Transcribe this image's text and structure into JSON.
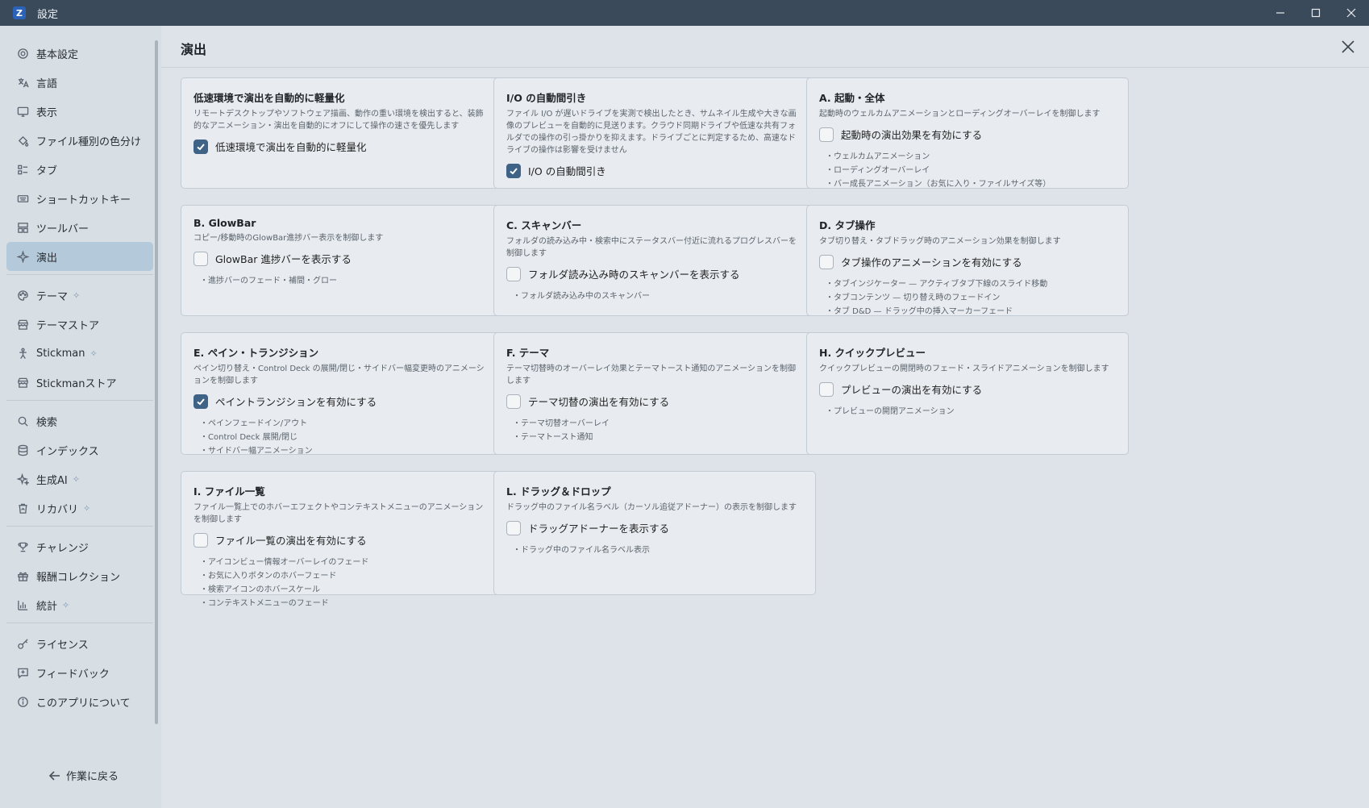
{
  "window": {
    "title": "設定",
    "app_icon_letter": "Z"
  },
  "sidebar": {
    "items": [
      {
        "label": "基本設定",
        "icon": "gear-icon"
      },
      {
        "label": "言語",
        "icon": "translate-icon"
      },
      {
        "label": "表示",
        "icon": "monitor-icon"
      },
      {
        "label": "ファイル種別の色分け",
        "icon": "paint-bucket-icon"
      },
      {
        "label": "タブ",
        "icon": "tabs-list-icon"
      },
      {
        "label": "ショートカットキー",
        "icon": "keyboard-icon"
      },
      {
        "label": "ツールバー",
        "icon": "toolbar-grid-icon"
      },
      {
        "label": "演出",
        "icon": "sparkle-icon",
        "active": true
      },
      {
        "label": "テーマ",
        "icon": "palette-icon",
        "sparkle": true
      },
      {
        "label": "テーマストア",
        "icon": "store-icon"
      },
      {
        "label": "Stickman",
        "icon": "stickman-icon",
        "sparkle": true
      },
      {
        "label": "Stickmanストア",
        "icon": "store-icon"
      },
      {
        "label": "検索",
        "icon": "search-icon"
      },
      {
        "label": "インデックス",
        "icon": "database-icon"
      },
      {
        "label": "生成AI",
        "icon": "ai-sparkle-icon",
        "sparkle": true
      },
      {
        "label": "リカバリ",
        "icon": "trash-restore-icon",
        "sparkle": true
      },
      {
        "label": "チャレンジ",
        "icon": "trophy-icon"
      },
      {
        "label": "報酬コレクション",
        "icon": "gift-icon"
      },
      {
        "label": "統計",
        "icon": "bar-chart-icon",
        "sparkle": true
      },
      {
        "label": "ライセンス",
        "icon": "key-icon"
      },
      {
        "label": "フィードバック",
        "icon": "feedback-icon"
      },
      {
        "label": "このアプリについて",
        "icon": "info-icon"
      }
    ],
    "back_label": "作業に戻る"
  },
  "main": {
    "title": "演出",
    "cards": [
      {
        "title": "低速環境で演出を自動的に軽量化",
        "desc": "リモートデスクトップやソフトウェア描画、動作の重い環境を検出すると、装飾的なアニメーション・演出を自動的にオフにして操作の速さを優先します",
        "checkbox_label": "低速環境で演出を自動的に軽量化",
        "checked": true,
        "bullets": []
      },
      {
        "title": "I/O の自動間引き",
        "desc": "ファイル I/O が遅いドライブを実測で検出したとき、サムネイル生成や大きな画像のプレビューを自動的に見送ります。クラウド同期ドライブや低速な共有フォルダでの操作の引っ掛かりを抑えます。ドライブごとに判定するため、高速なドライブの操作は影響を受けません",
        "checkbox_label": "I/O の自動間引き",
        "checked": true,
        "bullets": []
      },
      {
        "title": "A. 起動・全体",
        "desc": "起動時のウェルカムアニメーションとローディングオーバーレイを制御します",
        "checkbox_label": "起動時の演出効果を有効にする",
        "checked": false,
        "bullets": [
          "ウェルカムアニメーション",
          "ローディングオーバーレイ",
          "バー成長アニメーション（お気に入り・ファイルサイズ等）"
        ]
      },
      {
        "title": "B. GlowBar",
        "desc": "コピー/移動時のGlowBar進捗バー表示を制御します",
        "checkbox_label": "GlowBar 進捗バーを表示する",
        "checked": false,
        "bullets": [
          "進捗バーのフェード・補間・グロー"
        ]
      },
      {
        "title": "C. スキャンバー",
        "desc": "フォルダの読み込み中・検索中にステータスバー付近に流れるプログレスバーを制御します",
        "checkbox_label": "フォルダ読み込み時のスキャンバーを表示する",
        "checked": false,
        "bullets": [
          "フォルダ読み込み中のスキャンバー"
        ]
      },
      {
        "title": "D. タブ操作",
        "desc": "タブ切り替え・タブドラッグ時のアニメーション効果を制御します",
        "checkbox_label": "タブ操作のアニメーションを有効にする",
        "checked": false,
        "bullets": [
          "タブインジケーター — アクティブタブ下線のスライド移動",
          "タブコンテンツ — 切り替え時のフェードイン",
          "タブ D&D — ドラッグ中の挿入マーカーフェード"
        ]
      },
      {
        "title": "E. ペイン・トランジション",
        "desc": "ペイン切り替え・Control Deck の展開/閉じ・サイドバー幅変更時のアニメーションを制御します",
        "checkbox_label": "ペイントランジションを有効にする",
        "checked": true,
        "bullets": [
          "ペインフェードイン/アウト",
          "Control Deck 展開/閉じ",
          "サイドバー幅アニメーション"
        ]
      },
      {
        "title": "F. テーマ",
        "desc": "テーマ切替時のオーバーレイ効果とテーマトースト通知のアニメーションを制御します",
        "checkbox_label": "テーマ切替の演出を有効にする",
        "checked": false,
        "bullets": [
          "テーマ切替オーバーレイ",
          "テーマトースト通知"
        ]
      },
      {
        "title": "H. クイックプレビュー",
        "desc": "クイックプレビューの開閉時のフェード・スライドアニメーションを制御します",
        "checkbox_label": "プレビューの演出を有効にする",
        "checked": false,
        "bullets": [
          "プレビューの開閉アニメーション"
        ]
      },
      {
        "title": "I. ファイル一覧",
        "desc": "ファイル一覧上でのホバーエフェクトやコンテキストメニューのアニメーションを制御します",
        "checkbox_label": "ファイル一覧の演出を有効にする",
        "checked": false,
        "bullets": [
          "アイコンビュー情報オーバーレイのフェード",
          "お気に入りボタンのホバーフェード",
          "検索アイコンのホバースケール",
          "コンテキストメニューのフェード"
        ]
      },
      {
        "title": "L. ドラッグ＆ドロップ",
        "desc": "ドラッグ中のファイル名ラベル（カーソル追従アドーナー）の表示を制御します",
        "checkbox_label": "ドラッグアドーナーを表示する",
        "checked": false,
        "bullets": [
          "ドラッグ中のファイル名ラベル表示"
        ]
      }
    ]
  }
}
